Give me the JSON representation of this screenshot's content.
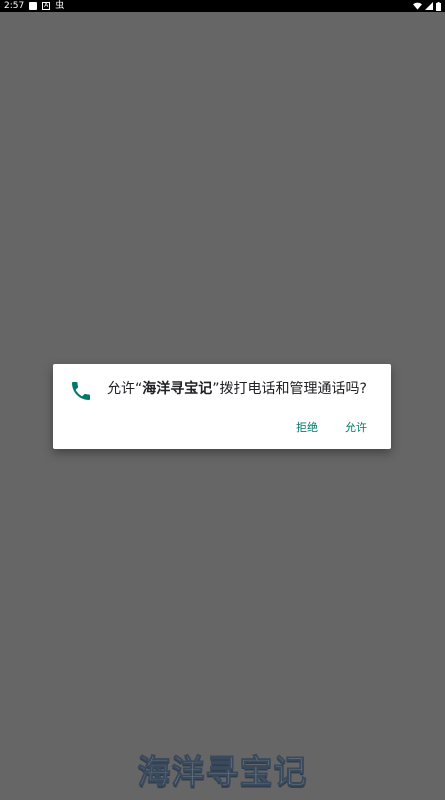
{
  "status_bar": {
    "time": "2:57",
    "icons": [
      "square-icon",
      "a-icon",
      "bug-icon",
      "wifi-icon",
      "signal-icon",
      "battery-icon"
    ]
  },
  "dialog": {
    "message_prefix": "允许“",
    "app_name": "海洋寻宝记",
    "message_suffix": "”拨打电话和管理通话吗?",
    "icon": "phone-icon",
    "deny_label": "拒绝",
    "allow_label": "允许",
    "accent_color": "#00796b"
  },
  "background": {
    "logo_text": "海洋寻宝记",
    "overlay_color": "#666666"
  }
}
